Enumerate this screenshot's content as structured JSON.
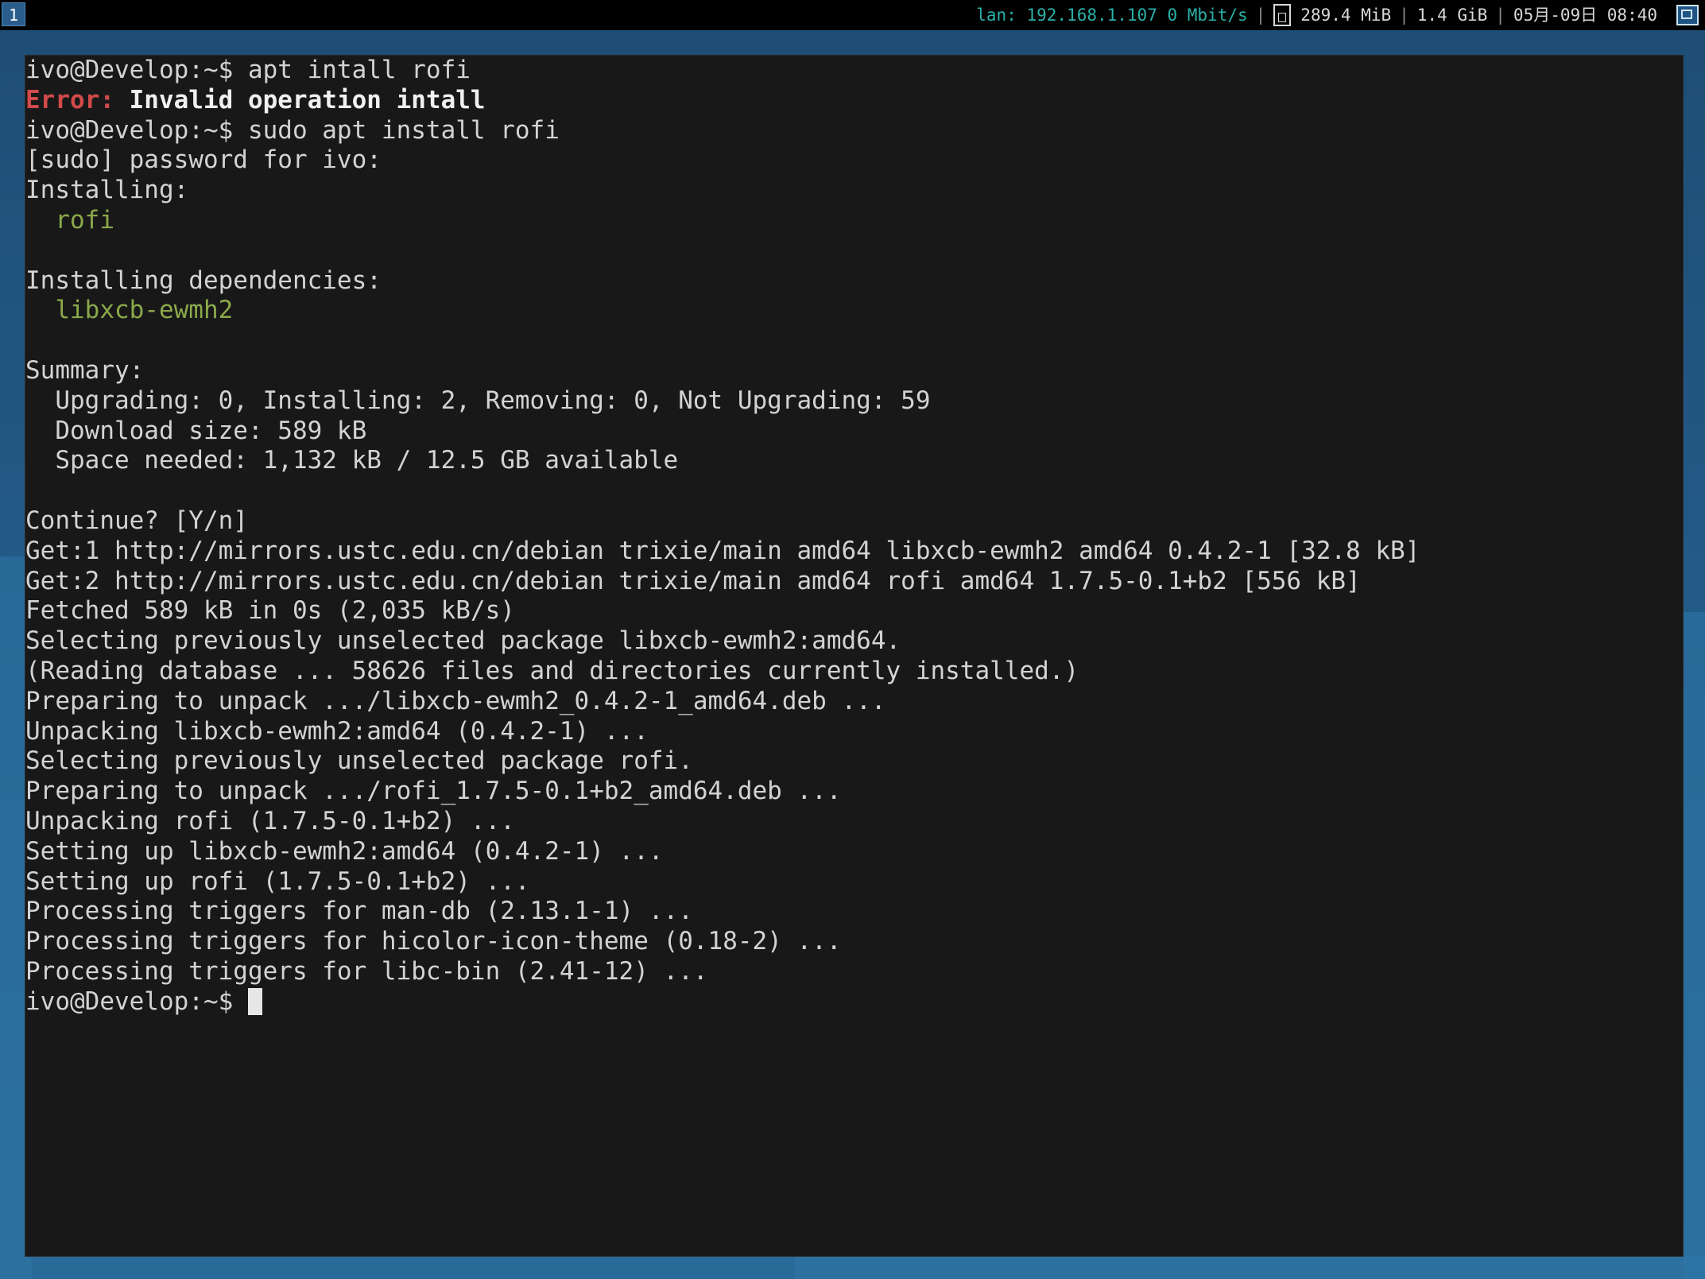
{
  "topbar": {
    "workspace": "1",
    "network": "lan: 192.168.1.107 0 Mbit/s",
    "separator": "|",
    "memory_used": "289.4 MiB",
    "memory_total": "1.4 GiB",
    "datetime": "05月-09日 08:40",
    "icons": [
      "memory-icon",
      "window-layout-icon"
    ]
  },
  "terminal": {
    "prompt": "ivo@Develop:~$",
    "lines": [
      {
        "text": "ivo@Develop:~$ apt intall rofi"
      },
      {
        "label": "Error:",
        "text": " Invalid operation intall"
      },
      {
        "text": "ivo@Develop:~$ sudo apt install rofi"
      },
      {
        "text": "[sudo] password for ivo:"
      },
      {
        "text": "Installing:"
      },
      {
        "indent": "  ",
        "pkg": "rofi"
      },
      {
        "text": ""
      },
      {
        "text": "Installing dependencies:"
      },
      {
        "indent": "  ",
        "pkg": "libxcb-ewmh2"
      },
      {
        "text": ""
      },
      {
        "text": "Summary:"
      },
      {
        "text": "  Upgrading: 0, Installing: 2, Removing: 0, Not Upgrading: 59"
      },
      {
        "text": "  Download size: 589 kB"
      },
      {
        "text": "  Space needed: 1,132 kB / 12.5 GB available"
      },
      {
        "text": ""
      },
      {
        "text": "Continue? [Y/n]"
      },
      {
        "text": "Get:1 http://mirrors.ustc.edu.cn/debian trixie/main amd64 libxcb-ewmh2 amd64 0.4.2-1 [32.8 kB]"
      },
      {
        "text": "Get:2 http://mirrors.ustc.edu.cn/debian trixie/main amd64 rofi amd64 1.7.5-0.1+b2 [556 kB]"
      },
      {
        "text": "Fetched 589 kB in 0s (2,035 kB/s)"
      },
      {
        "text": "Selecting previously unselected package libxcb-ewmh2:amd64."
      },
      {
        "text": "(Reading database ... 58626 files and directories currently installed.)"
      },
      {
        "text": "Preparing to unpack .../libxcb-ewmh2_0.4.2-1_amd64.deb ..."
      },
      {
        "text": "Unpacking libxcb-ewmh2:amd64 (0.4.2-1) ..."
      },
      {
        "text": "Selecting previously unselected package rofi."
      },
      {
        "text": "Preparing to unpack .../rofi_1.7.5-0.1+b2_amd64.deb ..."
      },
      {
        "text": "Unpacking rofi (1.7.5-0.1+b2) ..."
      },
      {
        "text": "Setting up libxcb-ewmh2:amd64 (0.4.2-1) ..."
      },
      {
        "text": "Setting up rofi (1.7.5-0.1+b2) ..."
      },
      {
        "text": "Processing triggers for man-db (2.13.1-1) ..."
      },
      {
        "text": "Processing triggers for hicolor-icon-theme (0.18-2) ..."
      },
      {
        "text": "Processing triggers for libc-bin (2.41-12) ..."
      }
    ],
    "current_input": ""
  },
  "colors": {
    "error": "#d24a4a",
    "package": "#8aa94a",
    "network": "#2ab0a8",
    "terminal_bg": "#181818",
    "text": "#d3d3d3"
  }
}
